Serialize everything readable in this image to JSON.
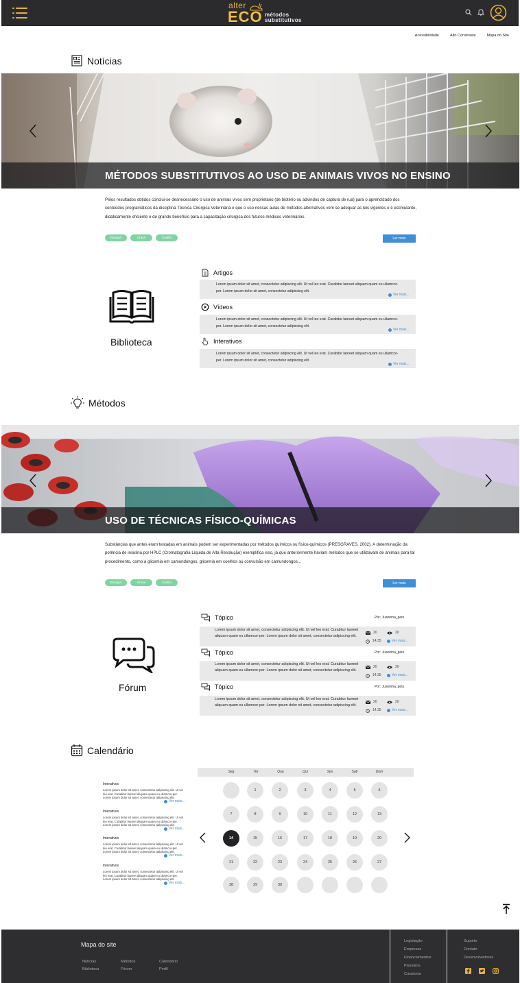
{
  "header": {
    "logo_alter": "alter",
    "logo_eco": "ECO",
    "logo_sub_1": "métodos",
    "logo_sub_2": "substitutivos",
    "accent": "#e6b23d"
  },
  "accessibility": [
    "Acessibilidade",
    "Alto Constraste",
    "Mapa do Site"
  ],
  "noticias": {
    "title": "Notícias",
    "banner_title": "MÉTODOS SUBSTITUTIVOS AO USO DE ANIMAIS VIVOS NO ENSINO",
    "summary": "Pelos resultados obtidos conclui-se desnecessário o uso de animais vivos sem proprietário (de biotério ou advindos de captura de rua) para o aprendizado dos conteúdos programáticos da disciplina Técnica Cirúrgica Veterinária e que o uso nessas aulas de métodos alternativos vem se adequar as leis vigentes e é estimulante, didaticamente eficiente e de grande benefício para a capacitação cirúrgica dos futuros médicos veterinários.",
    "tags": [
      "Biologia",
      "Drace",
      "Coelho"
    ],
    "more": "Ler mais"
  },
  "biblioteca": {
    "label": "Biblioteca",
    "items": [
      {
        "title": "Artigos",
        "text": "Lorem ipsum dolor sit amet, consectetur adipiscing elit. Ut vel leo erat. Curabitur laoreet aliquam quam eu ullamcor-per. Lorem ipsum dolor sit amet, consectetur adipiscing elit.",
        "more": "Ver mais..."
      },
      {
        "title": "Vídeos",
        "text": "Lorem ipsum dolor sit amet, consectetur adipiscing elit. Ut vel leo erat. Curabitur laoreet aliquam quam eu ullamcor-per. Lorem ipsum dolor sit amet, consectetur adipiscing elit.",
        "more": "Ver mais..."
      },
      {
        "title": "Interativos",
        "text": "Lorem ipsum dolor sit amet, consectetur adipiscing elit. Ut vel leo erat. Curabitur laoreet aliquam quam eu ullamcor-per. Lorem ipsum dolor sit amet, consectetur adipiscing elit.",
        "more": "Ver mais..."
      }
    ]
  },
  "metodos": {
    "title": "Métodos",
    "banner_title": "USO DE TÉCNICAS FÍSICO-QUÍMICAS",
    "summary": "Substâncias que antes eram testadas em animais podem ser experimentadas por métodos químicos ou físico-químicos (PRESGRAVES, 2002). A determinação da potência de insulina por HPLC (Cromatografia Líquida de Alta Resolução) exemplifica isso, já que anteriormente haviam métodos que se utilizavam de animais para tal procedimento, como a glicemia em camundongos, glicemia em coelhos ou convulsão em camundongos...",
    "tags": [
      "Biologia",
      "Drace",
      "Coelho"
    ],
    "more": "Ler mais"
  },
  "forum": {
    "label": "Fórum",
    "topics": [
      {
        "title": "Tópico",
        "by": "Por:   Juaninha_pets",
        "text": "Lorem ipsum dolor sit amet, consectetur adipiscing elit. Ut vel leo erat. Curabitur laoreet aliquam quam eu ullamcor-per. Lorem ipsum dolor sit amet, consectetur adipiscing elit.",
        "messages": "20",
        "views": "20",
        "time": "14:35",
        "more": "Ver mais..."
      },
      {
        "title": "Tópico",
        "by": "Por:   Juaninha_pets",
        "text": "Lorem ipsum dolor sit amet, consectetur adipiscing elit. Ut vel leo erat. Curabitur laoreet aliquam quam eu ullamcor-per. Lorem ipsum dolor sit amet, consectetur adipiscing elit.",
        "messages": "20",
        "views": "20",
        "time": "14:35",
        "more": "Ver mais..."
      },
      {
        "title": "Tópico",
        "by": "Por:   Juaninha_pets",
        "text": "Lorem ipsum dolor sit amet, consectetur adipiscing elit. Ut vel leo erat. Curabitur laoreet aliquam quam eu ullamcor-per. Lorem ipsum dolor sit amet, consectetur adipiscing elit.",
        "messages": "20",
        "views": "20",
        "time": "14:35",
        "more": "Ver mais..."
      }
    ]
  },
  "calendario": {
    "title": "Calendário",
    "weekdays": [
      "Seg",
      "Ter",
      "Qua",
      "Qui",
      "Sex",
      "Sab",
      "Dom"
    ],
    "days": [
      "",
      "1",
      "2",
      "3",
      "4",
      "5",
      "6",
      "7",
      "8",
      "9",
      "10",
      "11",
      "12",
      "13",
      "14",
      "15",
      "16",
      "17",
      "18",
      "19",
      "20",
      "21",
      "22",
      "23",
      "24",
      "25",
      "26",
      "27",
      "28",
      "29",
      "30",
      "",
      "",
      "",
      ""
    ],
    "selected": "14",
    "events": [
      {
        "title": "Interativos",
        "text": "Lorem ipsum dolor sit amet, consectetur adipiscing elit. Ut vel leo erat. Curabitur laoreet aliquam quam eu ullamcor-per. Lorem ipsum dolor sit amet, consectetur adipiscing elit.",
        "more": "Ver mais..."
      },
      {
        "title": "Interativos",
        "text": "Lorem ipsum dolor sit amet, consectetur adipiscing elit. Ut vel leo erat. Curabitur laoreet aliquam quam eu ullamcor-per. Lorem ipsum dolor sit amet, consectetur adipiscing elit.",
        "more": "Ver mais..."
      },
      {
        "title": "Interativos",
        "text": "Lorem ipsum dolor sit amet, consectetur adipiscing elit. Ut vel leo erat. Curabitur laoreet aliquam quam eu ullamcor-per. Lorem ipsum dolor sit amet, consectetur adipiscing elit.",
        "more": "Ver mais..."
      },
      {
        "title": "Interativos",
        "text": "Lorem ipsum dolor sit amet, consectetur adipiscing elit. Ut vel leo erat. Curabitur laoreet aliquam quam eu ullamcor-per. Lorem ipsum dolor sit amet, consectetur adipiscing elit.",
        "more": "Ver mais..."
      }
    ]
  },
  "footer": {
    "title": "Mapa do site",
    "links_col1": [
      "Notícias",
      "Biblioteca"
    ],
    "links_col2": [
      "Métodos",
      "Fórum"
    ],
    "links_col3": [
      "Calendário",
      "Perfil"
    ],
    "links_col4": [
      "Legislação",
      "Empresas",
      "Financiamentos",
      "Parceiros",
      "Curadoria"
    ],
    "links_col5": [
      "Suporte",
      "Contato",
      "Desenvolvedores"
    ],
    "social": [
      "facebook-icon",
      "twitter-icon",
      "instagram-icon"
    ],
    "accent": "#e6b23d"
  }
}
